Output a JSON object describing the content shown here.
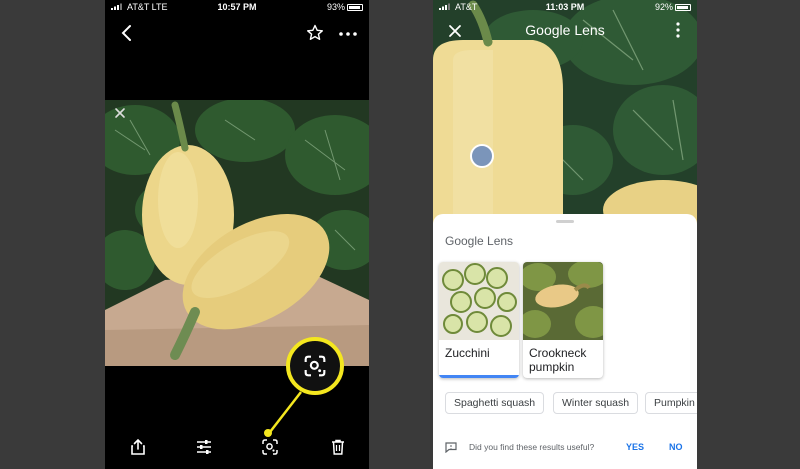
{
  "left_phone": {
    "status": {
      "carrier": "AT&T LTE",
      "time": "10:57 PM",
      "battery": "93%"
    }
  },
  "right_phone": {
    "status": {
      "carrier": "AT&T",
      "time": "11:03 PM",
      "battery": "92%"
    },
    "title": "Google Lens",
    "sheet": {
      "title": "Google Lens",
      "results": [
        {
          "label": "Zucchini"
        },
        {
          "label": "Crookneck pumpkin"
        }
      ],
      "chips": [
        "Spaghetti squash",
        "Winter squash",
        "Pumpkin"
      ],
      "feedback": {
        "question": "Did you find these results useful?",
        "yes": "YES",
        "no": "NO"
      }
    }
  },
  "colors": {
    "highlight": "#f4e71f",
    "accent": "#1a73e8",
    "focus_dot": "#7b95ba"
  },
  "icons": [
    "back-arrow-icon",
    "star-icon",
    "more-horizontal-icon",
    "close-icon",
    "lens-icon",
    "share-icon",
    "adjust-icon",
    "delete-icon",
    "more-vertical-icon",
    "feedback-icon"
  ]
}
